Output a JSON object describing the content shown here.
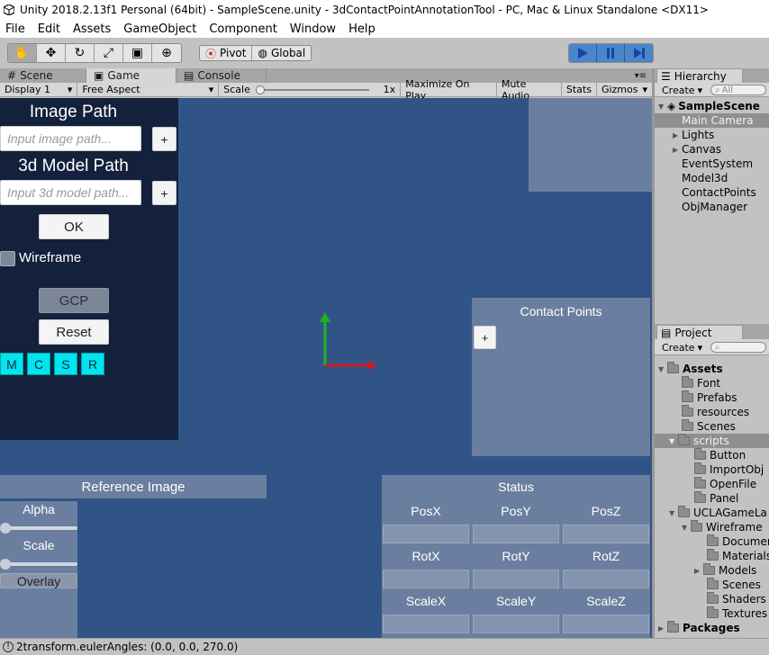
{
  "window": {
    "title": "Unity 2018.2.13f1 Personal (64bit) - SampleScene.unity - 3dContactPointAnnotationTool - PC, Mac & Linux Standalone <DX11>"
  },
  "menu": [
    "File",
    "Edit",
    "Assets",
    "GameObject",
    "Component",
    "Window",
    "Help"
  ],
  "toolbar": {
    "pivot_label": "Pivot",
    "global_label": "Global"
  },
  "tabs": {
    "scene": "Scene",
    "game": "Game",
    "console": "Console"
  },
  "gamebar": {
    "display": "Display 1",
    "aspect": "Free Aspect",
    "scale_label": "Scale",
    "scale_value": "1x",
    "maximize": "Maximize On Play",
    "mute": "Mute Audio",
    "stats": "Stats",
    "gizmos": "Gizmos"
  },
  "leftpanel": {
    "image_path_title": "Image Path",
    "image_path_placeholder": "Input image path...",
    "model_path_title": "3d Model Path",
    "model_path_placeholder": "Input 3d model path...",
    "plus": "+",
    "ok": "OK",
    "wireframe": "Wireframe",
    "gcp": "GCP",
    "reset": "Reset",
    "mode_buttons": [
      "M",
      "C",
      "S",
      "R"
    ]
  },
  "contact_points": {
    "title": "Contact Points",
    "plus": "+"
  },
  "reference_image": {
    "title": "Reference Image",
    "alpha": "Alpha",
    "scale": "Scale",
    "overlay": "Overlay"
  },
  "status": {
    "title": "Status",
    "rows": [
      [
        "PosX",
        "PosY",
        "PosZ"
      ],
      [
        "RotX",
        "RotY",
        "RotZ"
      ],
      [
        "ScaleX",
        "ScaleY",
        "ScaleZ"
      ]
    ]
  },
  "hierarchy": {
    "tab": "Hierarchy",
    "create": "Create",
    "search_placeholder": "All",
    "scene": "SampleScene",
    "items": [
      "Main Camera",
      "Lights",
      "Canvas",
      "EventSystem",
      "Model3d",
      "ContactPoints",
      "ObjManager"
    ]
  },
  "project": {
    "tab": "Project",
    "create": "Create",
    "assets": "Assets",
    "tree": [
      "Font",
      "Prefabs",
      "resources",
      "Scenes",
      "scripts",
      "Button",
      "ImportObj",
      "OpenFile",
      "Panel",
      "UCLAGameLa",
      "Wireframe",
      "Documer",
      "Materials",
      "Models",
      "Scenes",
      "Shaders",
      "Textures"
    ],
    "packages": "Packages"
  },
  "statusbar": {
    "message": "2transform.eulerAngles: (0.0, 0.0, 270.0)"
  }
}
